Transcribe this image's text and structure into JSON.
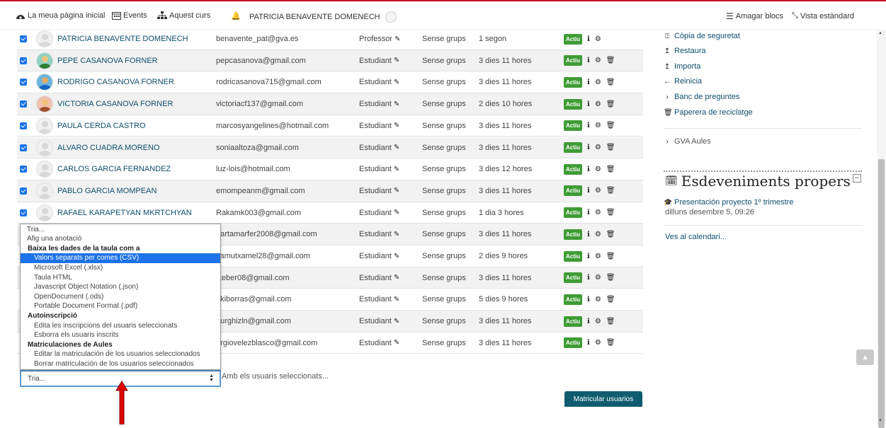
{
  "navbar": {
    "home": "La meua pàgina inicial",
    "events": "Events",
    "course": "Aquest curs",
    "user": "PATRICIA BENAVENTE DOMENECH",
    "hide_blocks": "Amagar blocs",
    "standard_view": "Vista estàndard"
  },
  "participants": [
    {
      "name": "PATRICIA BENAVENTE DOMENECH",
      "email": "benavente_pat@gva.es",
      "role": "Professor",
      "group": "Sense grups",
      "last_access": "1 segon",
      "status": "Actiu"
    },
    {
      "name": "PEPE CASANOVA FORNER",
      "email": "pepcasanova@gmail.com",
      "role": "Estudiant",
      "group": "Sense grups",
      "last_access": "3 dies 11 hores",
      "status": "Actiu"
    },
    {
      "name": "RODRIGO CASANOVA FORNER",
      "email": "rodricasanova715@gmail.com",
      "role": "Estudiant",
      "group": "Sense grups",
      "last_access": "3 dies 11 hores",
      "status": "Actiu"
    },
    {
      "name": "VICTORIA CASANOVA FORNER",
      "email": "victoriacf137@gmail.com",
      "role": "Estudiant",
      "group": "Sense grups",
      "last_access": "2 dies 10 hores",
      "status": "Actiu"
    },
    {
      "name": "PAULA CERDA CASTRO",
      "email": "marcosyangelines@hotmail.com",
      "role": "Estudiant",
      "group": "Sense grups",
      "last_access": "3 dies 11 hores",
      "status": "Actiu"
    },
    {
      "name": "ALVARO CUADRA MORENO",
      "email": "soniaaltoza@gmail.com",
      "role": "Estudiant",
      "group": "Sense grups",
      "last_access": "3 dies 11 hores",
      "status": "Actiu"
    },
    {
      "name": "CARLOS GARCIA FERNANDEZ",
      "email": "luz-lois@hotmail.com",
      "role": "Estudiant",
      "group": "Sense grups",
      "last_access": "3 dies 12 hores",
      "status": "Actiu"
    },
    {
      "name": "PABLO GARCIA MOMPEAN",
      "email": "emompeanm@gmail.com",
      "role": "Estudiant",
      "group": "Sense grups",
      "last_access": "3 dies 11 hores",
      "status": "Actiu"
    },
    {
      "name": "RAFAEL KARAPETYAN MKRTCHYAN",
      "email": "Rakamk003@gmail.com",
      "role": "Estudiant",
      "group": "Sense grups",
      "last_access": "1 dia 3 hores",
      "status": "Actiu"
    },
    {
      "name": "",
      "email": "nartamarfer2008@gmail.com",
      "role": "Estudiant",
      "group": "Sense grups",
      "last_access": "3 dies 11 hores",
      "status": "Actiu"
    },
    {
      "name": "",
      "email": "vamutxamel28@gmail.com",
      "role": "Estudiant",
      "group": "Sense grups",
      "last_access": "2 dies 9 hores",
      "status": "Actiu"
    },
    {
      "name": "",
      "email": "ikeber08@gmail.com",
      "role": "Estudiant",
      "group": "Sense grups",
      "last_access": "3 dies 11 hores",
      "status": "Actiu"
    },
    {
      "name": "",
      "email": "akiborras@gmail.com",
      "role": "Estudiant",
      "group": "Sense grups",
      "last_access": "5 dies 9 hores",
      "status": "Actiu"
    },
    {
      "name": "",
      "email": "eurghizln@gmail.com",
      "role": "Estudiant",
      "group": "Sense grups",
      "last_access": "3 dies 11 hores",
      "status": "Actiu"
    },
    {
      "name": "",
      "email": "ergiovelezblasco@gmail.com",
      "role": "Estudiant",
      "group": "Sense grups",
      "last_access": "3 dies 11 hores",
      "status": "Actiu"
    }
  ],
  "dropdown": {
    "options": [
      {
        "label": "Tria...",
        "kind": "top"
      },
      {
        "label": "Afig una anotació",
        "kind": "top"
      },
      {
        "label": "Baixa les dades de la taula com a",
        "kind": "grp"
      },
      {
        "label": "Valors separats per comes (CSV)",
        "kind": "ind",
        "selected": true
      },
      {
        "label": "Microsoft Excel (.xlsx)",
        "kind": "ind"
      },
      {
        "label": "Taula HTML",
        "kind": "ind"
      },
      {
        "label": "Javascript Object Notation (.json)",
        "kind": "ind"
      },
      {
        "label": "OpenDocument (.ods)",
        "kind": "ind"
      },
      {
        "label": "Portable Document Format (.pdf)",
        "kind": "ind"
      },
      {
        "label": "Autoinscripció",
        "kind": "grp"
      },
      {
        "label": "Edita les inscripcions del usuaris seleccionats",
        "kind": "ind"
      },
      {
        "label": "Esborra els usuaris inscrits",
        "kind": "ind"
      },
      {
        "label": "Matriculaciones de Aules",
        "kind": "grp"
      },
      {
        "label": "Editar la matriculación de los usuarios seleccionados",
        "kind": "ind"
      },
      {
        "label": "Borrar matriculación de los usuarios seleccionados",
        "kind": "ind"
      }
    ],
    "current_value": "Tria...",
    "with_selected": "Amb els usuaris seleccionats..."
  },
  "enroll_button": "Matricular usuarios",
  "sidebar": {
    "admin_items": [
      {
        "label": "Còpia de seguretat",
        "icon": "backup-icon"
      },
      {
        "label": "Restaura",
        "icon": "upload-icon"
      },
      {
        "label": "Importa",
        "icon": "upload-icon"
      },
      {
        "label": "Reinicia",
        "icon": "arrow-left-icon"
      },
      {
        "label": "Banc de preguntes",
        "icon": "chevron-right-icon"
      },
      {
        "label": "Paperera de reciclatge",
        "icon": "trash-icon"
      }
    ],
    "gva_aules": "GVA Aules",
    "events_title": "Esdeveniments propers",
    "event_name": "Presentación proyecto 1º trimestre",
    "event_date": "dilluns desembre 5, 09:26",
    "calendar_link": "Ves al calendari..."
  },
  "colors": {
    "accent": "#0f5c6e",
    "active_badge": "#3f9c35",
    "selected_option": "#1e73e8",
    "annotation_arrow": "#e00000"
  }
}
